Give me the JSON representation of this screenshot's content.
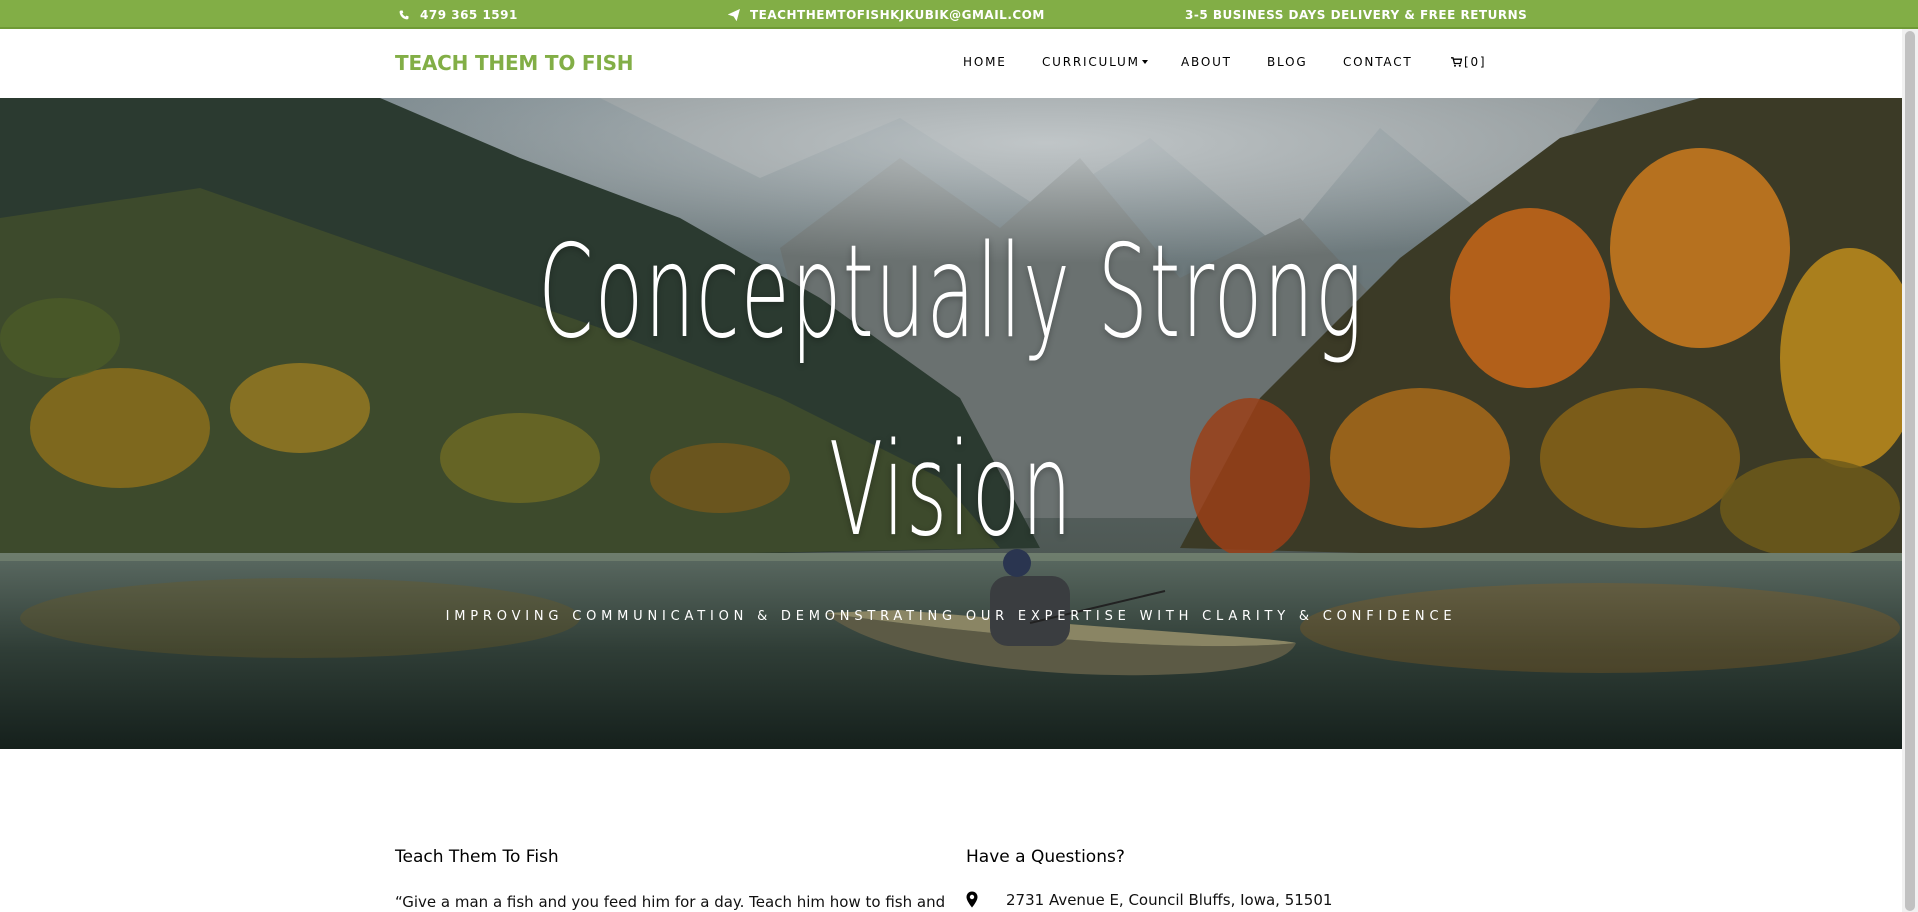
{
  "topbar": {
    "phone": "479 365 1591",
    "email": "TEACHTHEMTOFISHKJKUBIK@GMAIL.COM",
    "delivery": "3-5 BUSINESS DAYS DELIVERY & FREE RETURNS",
    "phone_icon": "phone-icon",
    "email_icon": "paper-plane-icon"
  },
  "nav": {
    "logo": "TEACH THEM TO FISH",
    "items": [
      "HOME",
      "CURRICULUM",
      "ABOUT",
      "BLOG",
      "CONTACT"
    ],
    "cart": "[0]",
    "cart_icon": "cart-icon"
  },
  "hero": {
    "title_line1": "Conceptually Strong",
    "title_line2": "Vision",
    "subtitle": "IMPROVING COMMUNICATION & DEMONSTRATING OUR EXPERTISE WITH CLARITY & CONFIDENCE"
  },
  "footer": {
    "about_title": "Teach Them To Fish",
    "about_quote": "“Give a man a fish and you feed him for a day. Teach him how to fish and",
    "contact_title": "Have a Questions?",
    "address": "2731 Avenue E, Council Bluffs, Iowa, 51501",
    "address_icon": "map-marker-icon"
  },
  "colors": {
    "brand_green": "#82ae46",
    "white": "#ffffff"
  }
}
